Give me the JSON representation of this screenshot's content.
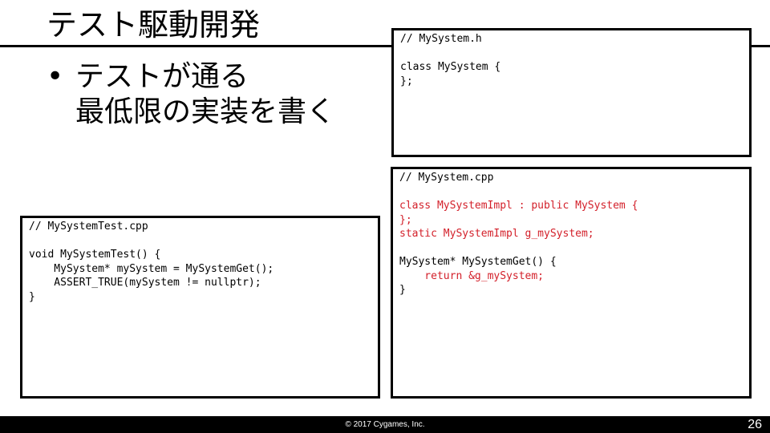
{
  "slide": {
    "title": "テスト駆動開発",
    "bullet": {
      "marker": "•",
      "lines": [
        "テストが通る",
        "最低限の実装を書く"
      ]
    }
  },
  "code_header": {
    "lines": [
      {
        "text": "// MySystem.h",
        "highlight": false
      },
      {
        "text": "",
        "highlight": false
      },
      {
        "text": "class MySystem {",
        "highlight": false
      },
      {
        "text": "};",
        "highlight": false
      }
    ]
  },
  "code_impl": {
    "lines": [
      {
        "text": "// MySystem.cpp",
        "highlight": false
      },
      {
        "text": "",
        "highlight": false
      },
      {
        "text": "class MySystemImpl : public MySystem {",
        "highlight": true
      },
      {
        "text": "};",
        "highlight": true
      },
      {
        "text": "static MySystemImpl g_mySystem;",
        "highlight": true
      },
      {
        "text": "",
        "highlight": false
      },
      {
        "text": "MySystem* MySystemGet() {",
        "highlight": false
      },
      {
        "text": "    return &g_mySystem;",
        "highlight": true
      },
      {
        "text": "}",
        "highlight": false
      }
    ]
  },
  "code_test": {
    "lines": [
      {
        "text": "// MySystemTest.cpp",
        "highlight": false
      },
      {
        "text": "",
        "highlight": false
      },
      {
        "text": "void MySystemTest() {",
        "highlight": false
      },
      {
        "text": "    MySystem* mySystem = MySystemGet();",
        "highlight": false
      },
      {
        "text": "    ASSERT_TRUE(mySystem != nullptr);",
        "highlight": false
      },
      {
        "text": "}",
        "highlight": false
      }
    ]
  },
  "colors": {
    "highlight": "#d3202a",
    "footer_bg": "#000000"
  },
  "footer": {
    "copyright": "© 2017 Cygames, Inc.",
    "page_number": "26"
  }
}
